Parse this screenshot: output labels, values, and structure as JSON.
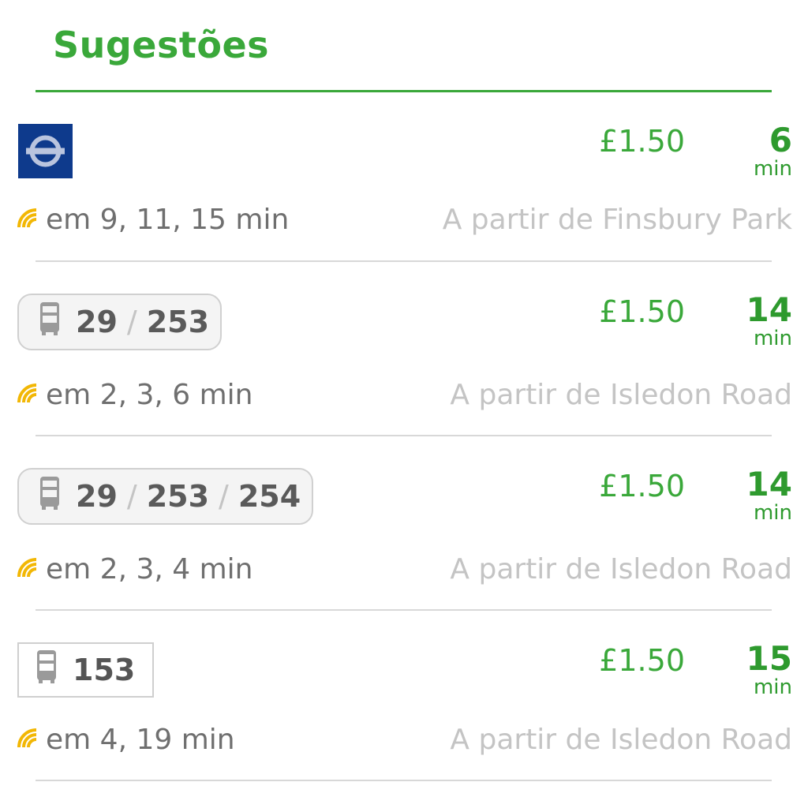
{
  "section": {
    "title": "Sugestões"
  },
  "rows": [
    {
      "mode": "tube",
      "routes": [],
      "price": "£1.50",
      "eta_value": "6",
      "eta_unit": "min",
      "live": "em 9, 11, 15 min",
      "from": "A partir de Finsbury Park"
    },
    {
      "mode": "bus",
      "routes": [
        "29",
        "253"
      ],
      "separator": "/",
      "price": "£1.50",
      "eta_value": "14",
      "eta_unit": "min",
      "live": "em 2, 3, 6 min",
      "from": "A partir de Isledon Road"
    },
    {
      "mode": "bus",
      "routes": [
        "29",
        "253",
        "254"
      ],
      "separator": "/",
      "price": "£1.50",
      "eta_value": "14",
      "eta_unit": "min",
      "live": "em 2, 3, 4 min",
      "from": "A partir de Isledon Road"
    },
    {
      "mode": "bus",
      "routes": [
        "153"
      ],
      "price": "£1.50",
      "eta_value": "15",
      "eta_unit": "min",
      "live": "em 4, 19 min",
      "from": "A partir de Isledon Road"
    }
  ],
  "colors": {
    "accent": "#3aa83a",
    "tube_blue": "#0e3a8c",
    "live_yellow": "#f2b705"
  },
  "icons": {
    "tube": "underground-roundel-icon",
    "bus": "bus-icon",
    "live": "realtime-signal-icon"
  }
}
